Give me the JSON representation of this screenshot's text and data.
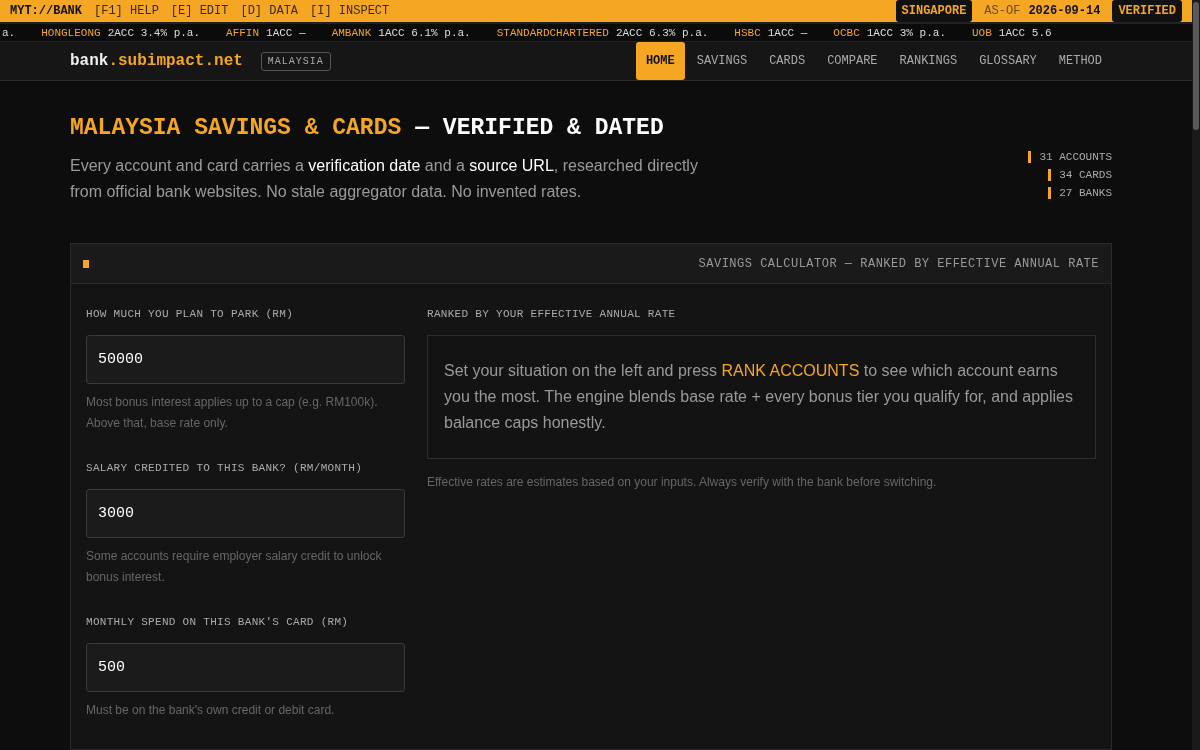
{
  "topbar": {
    "brand": "MYT://BANK",
    "shortcuts": [
      "[F1] HELP",
      "[E] EDIT",
      "[D] DATA",
      "[I] INSPECT"
    ],
    "region": "SINGAPORE",
    "asof_label": "AS-OF",
    "asof_date": "2026-09-14",
    "status": "VERIFIED"
  },
  "ticker": {
    "lead_fragment": "a.",
    "items": [
      {
        "bank": "HONGLEONG",
        "detail": "2ACC 3.4% p.a."
      },
      {
        "bank": "AFFIN",
        "detail": "1ACC —"
      },
      {
        "bank": "AMBANK",
        "detail": "1ACC 6.1% p.a."
      },
      {
        "bank": "STANDARDCHARTERED",
        "detail": "2ACC 6.3% p.a."
      },
      {
        "bank": "HSBC",
        "detail": "1ACC —"
      },
      {
        "bank": "OCBC",
        "detail": "1ACC 3% p.a."
      },
      {
        "bank": "UOB",
        "detail": "1ACC 5.6"
      }
    ]
  },
  "header": {
    "logo_main": "bank",
    "logo_domain": ".subimpact.net",
    "country": "MALAYSIA",
    "nav": [
      {
        "label": "HOME",
        "selected": true
      },
      {
        "label": "SAVINGS",
        "selected": false
      },
      {
        "label": "CARDS",
        "selected": false
      },
      {
        "label": "COMPARE",
        "selected": false
      },
      {
        "label": "RANKINGS",
        "selected": false
      },
      {
        "label": "GLOSSARY",
        "selected": false
      },
      {
        "label": "METHOD",
        "selected": false
      }
    ]
  },
  "hero": {
    "title_accent": "MALAYSIA SAVINGS & CARDS",
    "title_rest": "— VERIFIED & DATED",
    "description": [
      {
        "text": "Every account and card carries a ",
        "emphasis": false
      },
      {
        "text": "verification date",
        "emphasis": true
      },
      {
        "text": " and a ",
        "emphasis": false
      },
      {
        "text": "source URL",
        "emphasis": true
      },
      {
        "text": ", researched directly from official bank websites. No stale aggregator data. No invented rates.",
        "emphasis": false
      }
    ],
    "stats": [
      "31 ACCOUNTS",
      "34 CARDS",
      "27 BANKS"
    ]
  },
  "calculator": {
    "title": "SAVINGS CALCULATOR — RANKED BY EFFECTIVE ANNUAL RATE",
    "fields": [
      {
        "label": "HOW MUCH YOU PLAN TO PARK (RM)",
        "value": "50000",
        "hint": "Most bonus interest applies up to a cap (e.g. RM100k). Above that, base rate only."
      },
      {
        "label": "SALARY CREDITED TO THIS BANK? (RM/MONTH)",
        "value": "3000",
        "hint": "Some accounts require employer salary credit to unlock bonus interest."
      },
      {
        "label": "MONTHLY SPEND ON THIS BANK'S CARD (RM)",
        "value": "500",
        "hint": "Must be on the bank's own credit or debit card."
      }
    ],
    "results_label": "RANKED BY YOUR EFFECTIVE ANNUAL RATE",
    "results_message": [
      {
        "text": "Set your situation on the left and press ",
        "emphasis": false
      },
      {
        "text": "RANK ACCOUNTS",
        "emphasis": true
      },
      {
        "text": " to see which account earns you the most. The engine blends base rate + every bonus tier you qualify for, and applies balance caps honestly.",
        "emphasis": false
      }
    ],
    "disclaimer": "Effective rates are estimates based on your inputs. Always verify with the bank before switching."
  }
}
